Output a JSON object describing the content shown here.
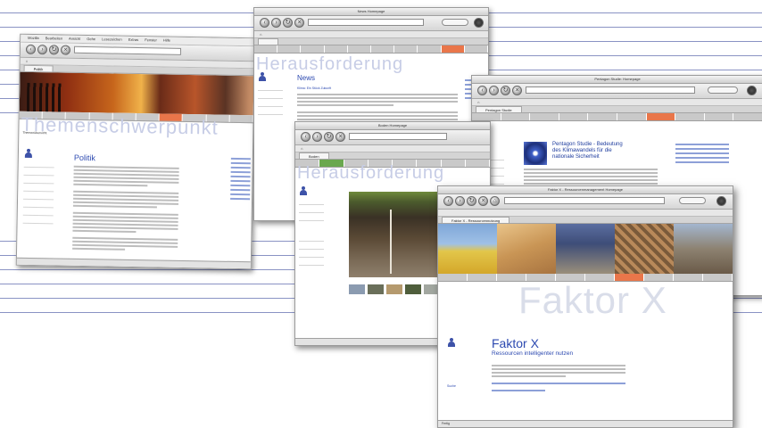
{
  "colors": {
    "rule": "#8a93c4",
    "accent_tab": "#e9764a",
    "title_blue": "#2c49b0",
    "watermark": "#c7cde6"
  },
  "background_rules_count": 14,
  "win_politik": {
    "menu": [
      "Mozilla",
      "Bearbeiten",
      "Ansicht",
      "Gehe",
      "Lesezeichen",
      "Extras",
      "Fenster",
      "Hilfe"
    ],
    "tab": "Politik",
    "nav": [
      "",
      "",
      "",
      "",
      "",
      "",
      "",
      "",
      "",
      ""
    ],
    "active_nav_index": 6,
    "watermark": "Themenschwerpunkt",
    "page_title": "Politik",
    "breadcrumb": "Themenübersicht"
  },
  "win_news": {
    "title": "News Homepage",
    "watermark": "Herausforderung",
    "page_title": "News",
    "subhead": "Klima: Ein Stück Zukunft"
  },
  "win_boden": {
    "title": "Boden Homepage",
    "tab": "Boden",
    "watermark": "Herausforderung"
  },
  "win_pentagon": {
    "title": "Pentagon Studie: Homepage",
    "tab": "Pentagon Studie",
    "page_title_lines": [
      "Pentagon Studie - Bedeutung",
      "des Klimawandels für die",
      "nationale Sicherheit"
    ]
  },
  "win_faktor": {
    "title": "Faktor X - Ressourcenmanagement Homepage",
    "tab": "Faktor X - Ressourcennutzung",
    "watermark": "Faktor X",
    "page_title": "Faktor X",
    "subtitle": "Ressourcen intelligenter nutzen",
    "search_label": "Suche",
    "status": "Fertig"
  },
  "icons": [
    "back-icon",
    "forward-icon",
    "reload-icon",
    "stop-icon",
    "home-icon",
    "search-icon",
    "throbber-icon"
  ]
}
